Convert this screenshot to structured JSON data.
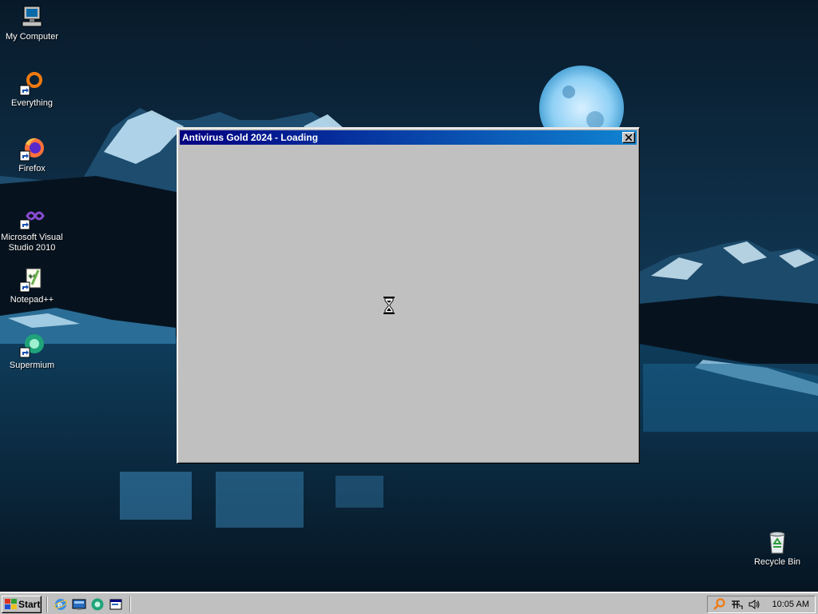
{
  "desktop": {
    "icons": [
      {
        "label": "My Computer",
        "icon": "my-computer-icon"
      },
      {
        "label": "Everything",
        "icon": "everything-search-icon"
      },
      {
        "label": "Firefox",
        "icon": "firefox-icon"
      },
      {
        "label": "Microsoft Visual Studio 2010",
        "icon": "visual-studio-icon"
      },
      {
        "label": "Notepad++",
        "icon": "notepad-plus-plus-icon"
      },
      {
        "label": "Supermium",
        "icon": "supermium-browser-icon"
      },
      {
        "label": "Recycle Bin",
        "icon": "recycle-bin-icon"
      }
    ]
  },
  "window": {
    "title": "Antivirus Gold 2024 - Loading",
    "close_icon": "close-icon",
    "cursor": "hourglass-icon"
  },
  "taskbar": {
    "start_label": "Start",
    "quick_launch": [
      "internet-explorer-icon",
      "show-desktop-icon",
      "browser-icon",
      "window-icon"
    ],
    "tray": {
      "icons": [
        "search-icon",
        "ime-icon",
        "volume-icon"
      ],
      "clock": "10:05 AM"
    }
  },
  "colors": {
    "title_bar_start": "#000080",
    "title_bar_end": "#1084d0",
    "window_face": "#c0c0c0"
  }
}
